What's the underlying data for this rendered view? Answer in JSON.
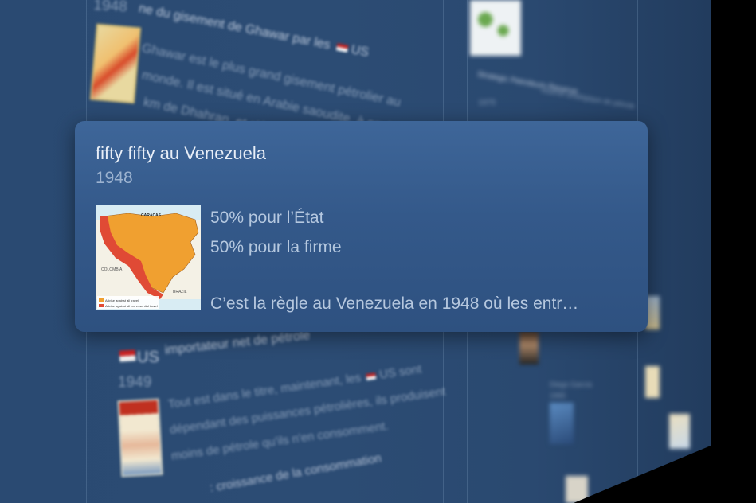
{
  "background": {
    "card_top": {
      "year": "1948",
      "title": "ne du gisement de Ghawar par les",
      "title_country": "US",
      "body_lines": [
        "Ghawar est le plus grand gisement pétrolier au",
        "monde. Il est situé en Arabie saoudite, à environ",
        "km de Dhahran, et s'éten..."
      ]
    },
    "card_bottom": {
      "country": "US",
      "title": "importateur net de pétrole",
      "year": "1949",
      "body_lines": [
        "Tout est dans le titre, maintenant, les",
        "dépendant des puissances pétrolières, ils produisent",
        "moins de pétrole qu'ils n'en consomment."
      ],
      "body_country": "US sont",
      "footer": ": croissance de la consommation"
    },
    "right_col": {
      "spr_title": "Strategic Petroleum Reserve",
      "spr_sub": "réserve stratégique de pétrole",
      "spr_year": "1975",
      "person_name": "Diego García",
      "person_year": "1965"
    }
  },
  "popup": {
    "title": "fifty fifty au Venezuela",
    "year": "1948",
    "line1": "50% pour l’État",
    "line2": "50% pour la firme",
    "snippet": "C’est la règle au Venezuela en 1948 où les entr…",
    "map": {
      "label_caracas": "CARACAS",
      "label_colombia": "COLOMBIA",
      "label_brazil": "BRAZIL",
      "legend1": "Advise against all travel",
      "legend2": "Advise against all but essential travel",
      "colors": {
        "orange": "#f0a030",
        "red": "#e04a35",
        "sea": "#d8ecf3",
        "land": "#f4f1e6"
      }
    }
  }
}
